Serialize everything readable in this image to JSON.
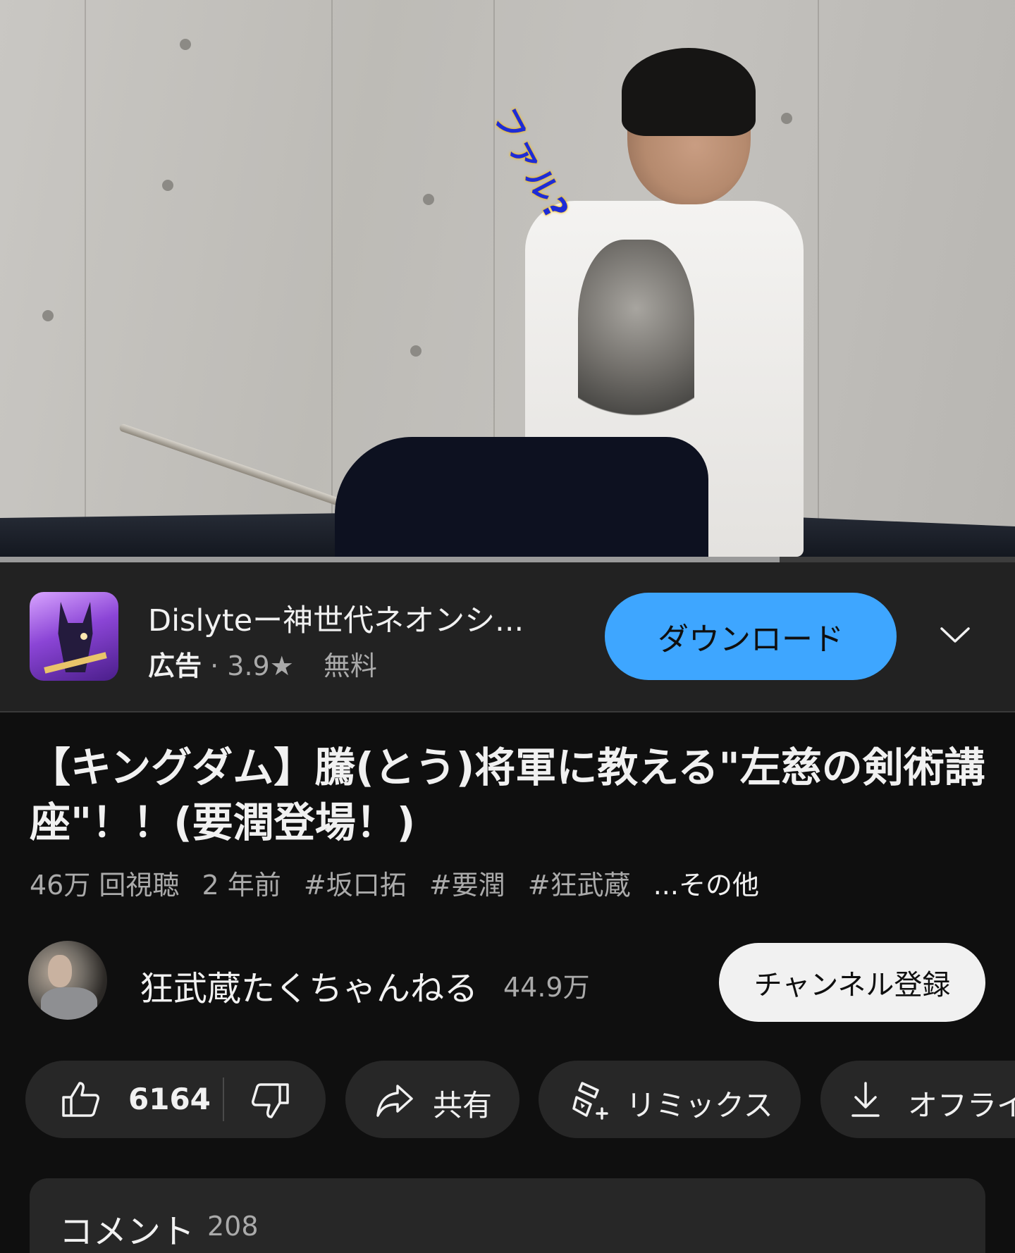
{
  "video": {
    "overlay_caption": "ファル?",
    "progress_fraction": 0.768
  },
  "ad": {
    "app_title": "Dislyteー神世代ネオンシ...",
    "badge": "広告",
    "rating": "3.9★",
    "price": "無料",
    "download_label": "ダウンロード",
    "expand_icon": "chevron-down-icon"
  },
  "video_info": {
    "title": "【キングダム】騰(とう)将軍に教える\"左慈の剣術講座\"！！(要潤登場！)",
    "views": "46万 回視聴",
    "age": "2 年前",
    "hashtags": [
      "#坂口拓",
      "#要潤",
      "#狂武蔵"
    ],
    "more": "...その他"
  },
  "channel": {
    "name": "狂武蔵たくちゃんねる",
    "subscribers": "44.9万",
    "subscribe_label": "チャンネル登録"
  },
  "actions": {
    "like_count": "6164",
    "share_label": "共有",
    "remix_label": "リミックス",
    "offline_label": "オフライ",
    "icons": [
      "thumb-up-icon",
      "thumb-down-icon",
      "share-icon",
      "remix-icon",
      "download-icon"
    ]
  },
  "comments": {
    "title": "コメント",
    "count": "208"
  },
  "colors": {
    "background": "#0f0f0f",
    "ad_background": "#222222",
    "pill_background": "#272727",
    "download_button": "#3ea6ff",
    "subscribe_button": "#f1f1f1",
    "overlay_text": "#1e2cd6"
  }
}
